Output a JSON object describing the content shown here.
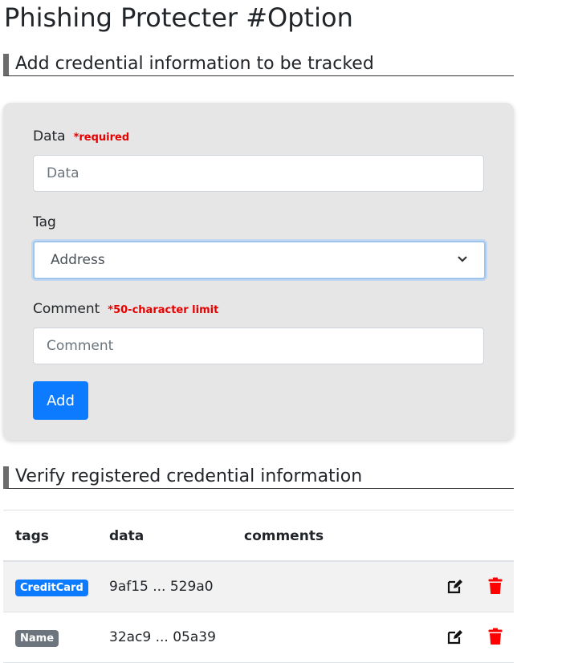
{
  "page_title": "Phishing Protecter #Option",
  "add_section": {
    "heading": "Add credential information to be tracked",
    "data_label": "Data",
    "data_note": "*required",
    "data_placeholder": "Data",
    "tag_label": "Tag",
    "tag_selected": "Address",
    "comment_label": "Comment",
    "comment_note": "*50-character limit",
    "comment_placeholder": "Comment",
    "add_button": "Add"
  },
  "verify_section": {
    "heading": "Verify registered credential information",
    "columns": [
      "tags",
      "data",
      "comments"
    ],
    "rows": [
      {
        "tag": "CreditCard",
        "tag_color": "#0d7bff",
        "data": "9af15 ... 529a0",
        "comment": ""
      },
      {
        "tag": "Name",
        "tag_color": "#6c757d",
        "data": "32ac9 ... 05a39",
        "comment": ""
      }
    ]
  },
  "icons": {
    "edit": "edit-icon",
    "delete": "trash-icon"
  },
  "colors": {
    "primary": "#0d7bff",
    "danger": "#ff0000",
    "required": "#e60000"
  }
}
